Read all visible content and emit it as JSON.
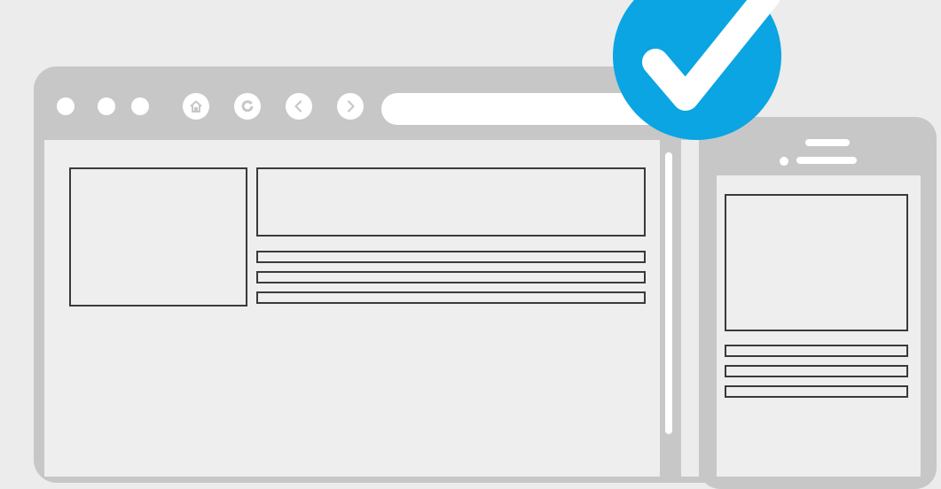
{
  "colors": {
    "background": "#ececec",
    "frame": "#c7c7c7",
    "content": "#eeeeee",
    "outline": "#3a3a3a",
    "accent": "#0aa5e2",
    "white": "#ffffff"
  },
  "browser": {
    "window_controls": [
      "window-dot",
      "window-dot",
      "window-dot"
    ],
    "nav_icons": [
      "home-icon",
      "refresh-icon",
      "back-icon",
      "forward-icon"
    ]
  },
  "badge": {
    "icon": "checkmark-icon"
  }
}
